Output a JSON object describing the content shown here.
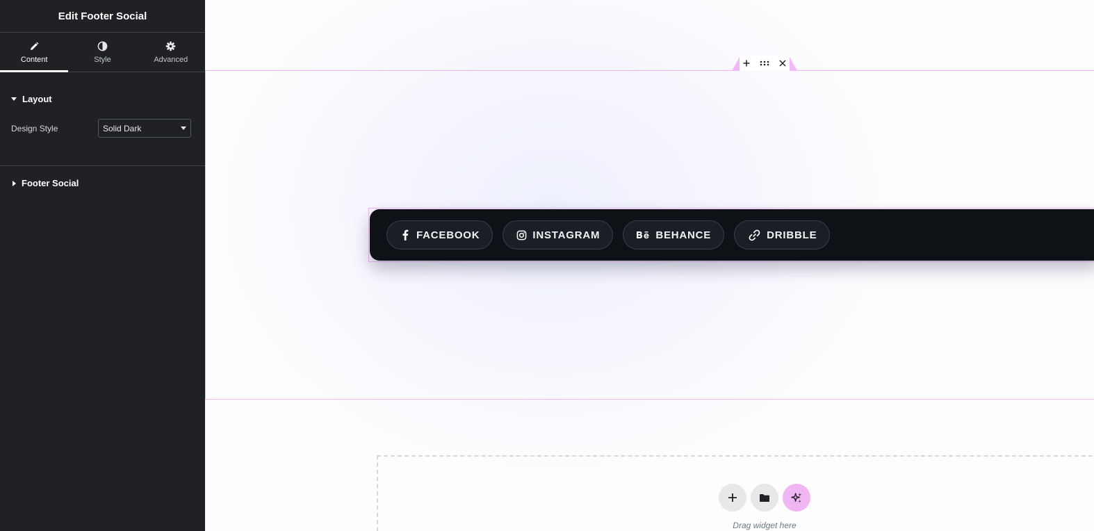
{
  "panel": {
    "title": "Edit Footer Social",
    "tabs": [
      {
        "label": "Content",
        "icon": "pencil-icon",
        "active": true
      },
      {
        "label": "Style",
        "icon": "contrast-icon",
        "active": false
      },
      {
        "label": "Advanced",
        "icon": "gear-icon",
        "active": false
      }
    ],
    "layout_section": {
      "title": "Layout",
      "expanded": true,
      "design_style": {
        "label": "Design Style",
        "value": "Solid Dark"
      }
    },
    "footer_social_section": {
      "title": "Footer Social",
      "expanded": false
    }
  },
  "canvas": {
    "section_handle": {
      "add": "+",
      "close": "×"
    },
    "social_links": [
      {
        "label": "FACEBOOK",
        "icon": "facebook-icon"
      },
      {
        "label": "INSTAGRAM",
        "icon": "instagram-icon"
      },
      {
        "label": "BEHANCE",
        "icon": "behance-icon"
      },
      {
        "label": "DRIBBLE",
        "icon": "link-icon"
      }
    ],
    "drop_zone": {
      "text": "Drag widget here"
    }
  },
  "colors": {
    "panel_bg": "#202124",
    "accent_pink": "#f0b6f4",
    "social_bar_bg": "#0e1116"
  }
}
